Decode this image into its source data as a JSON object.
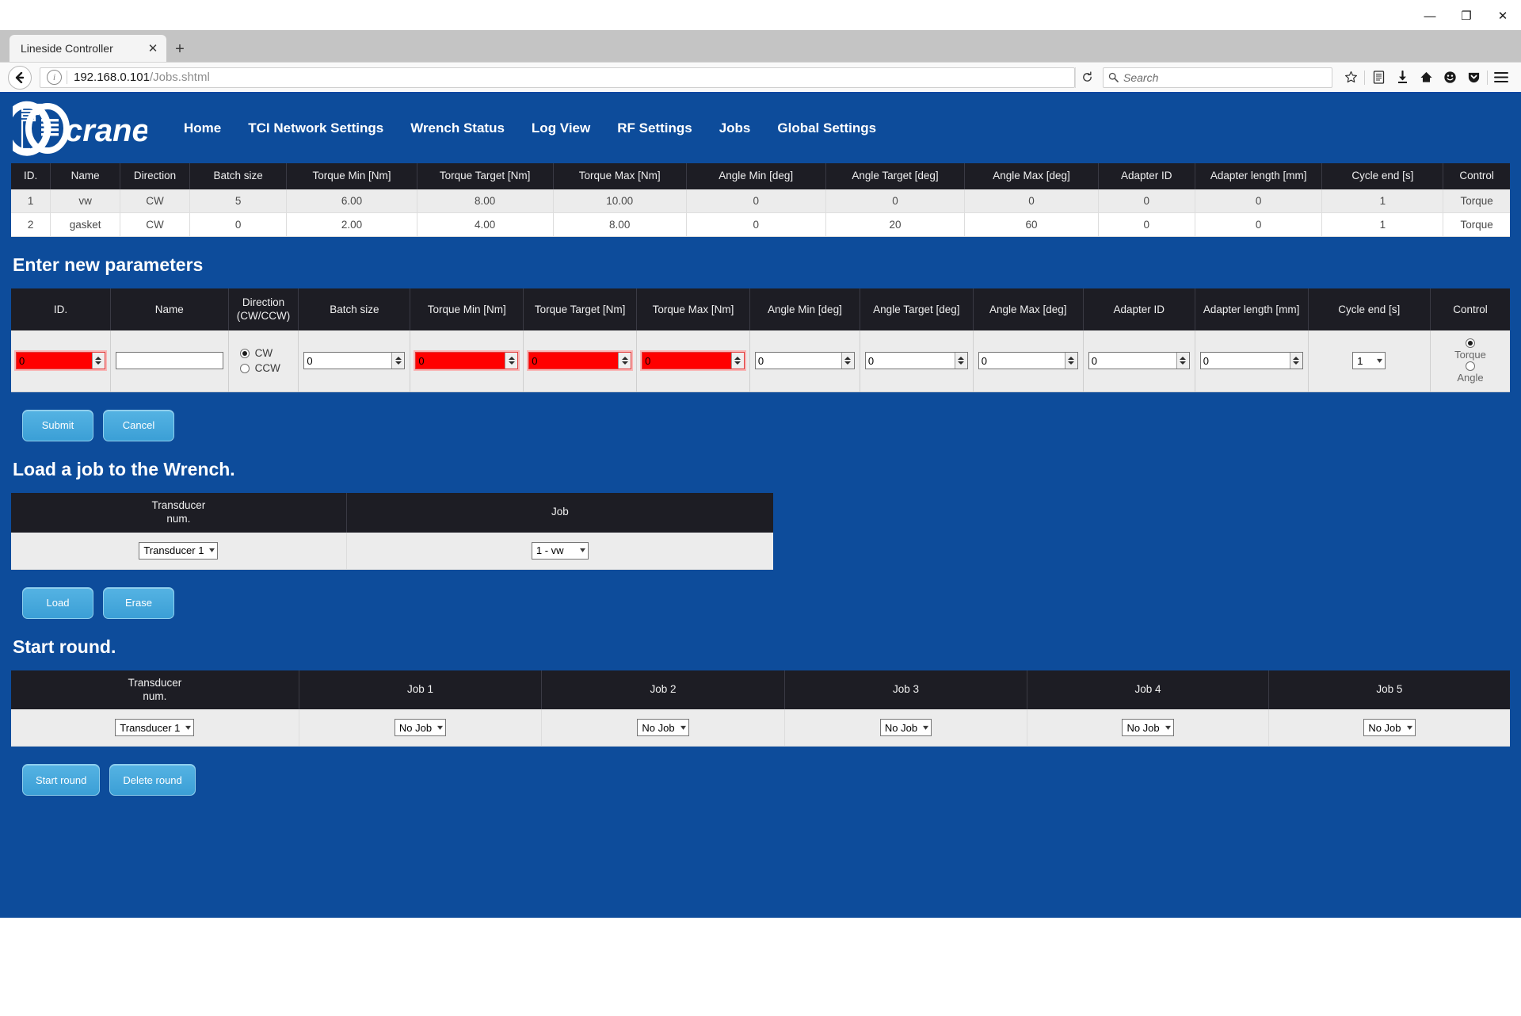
{
  "browser": {
    "tab_title": "Lineside Controller",
    "tab_close_icon": "close-icon",
    "new_tab_icon": "plus-icon",
    "window_minimize": "—",
    "window_restore": "❐",
    "window_close": "✕",
    "back_icon": "←",
    "info_icon": "i",
    "url_host": "192.168.0.101",
    "url_path": "/Jobs.shtml",
    "reload_icon": "↻",
    "search_placeholder": "Search",
    "toolbar_icons": [
      "star-icon",
      "reader-icon",
      "download-icon",
      "home-icon",
      "smiley-icon",
      "pocket-icon",
      "menu-icon"
    ]
  },
  "site": {
    "brand": "crane",
    "nav": [
      {
        "label": "Home"
      },
      {
        "label": "TCI Network Settings"
      },
      {
        "label": "Wrench Status"
      },
      {
        "label": "Log View"
      },
      {
        "label": "RF Settings"
      },
      {
        "label": "Jobs"
      },
      {
        "label": "Global Settings"
      }
    ]
  },
  "jobs_table": {
    "headers": [
      "ID.",
      "Name",
      "Direction",
      "Batch size",
      "Torque Min [Nm]",
      "Torque Target [Nm]",
      "Torque Max [Nm]",
      "Angle Min [deg]",
      "Angle Target [deg]",
      "Angle Max [deg]",
      "Adapter ID",
      "Adapter length [mm]",
      "Cycle end [s]",
      "Control"
    ],
    "rows": [
      {
        "id": "1",
        "name": "vw",
        "direction": "CW",
        "batch_size": "5",
        "torque_min": "6.00",
        "torque_target": "8.00",
        "torque_max": "10.00",
        "angle_min": "0",
        "angle_target": "0",
        "angle_max": "0",
        "adapter_id": "0",
        "adapter_length": "0",
        "cycle_end": "1",
        "control": "Torque"
      },
      {
        "id": "2",
        "name": "gasket",
        "direction": "CW",
        "batch_size": "0",
        "torque_min": "2.00",
        "torque_target": "4.00",
        "torque_max": "8.00",
        "angle_min": "0",
        "angle_target": "20",
        "angle_max": "60",
        "adapter_id": "0",
        "adapter_length": "0",
        "cycle_end": "1",
        "control": "Torque"
      }
    ]
  },
  "new_params": {
    "title": "Enter new parameters",
    "headers": {
      "id": "ID.",
      "name": "Name",
      "direction_l1": "Direction",
      "direction_l2": "(CW/CCW)",
      "batch_size": "Batch size",
      "torque_min": "Torque Min [Nm]",
      "torque_target": "Torque Target [Nm]",
      "torque_max": "Torque Max [Nm]",
      "angle_min": "Angle Min [deg]",
      "angle_target": "Angle Target [deg]",
      "angle_max": "Angle Max [deg]",
      "adapter_id": "Adapter ID",
      "adapter_length": "Adapter length [mm]",
      "cycle_end": "Cycle end [s]",
      "control": "Control"
    },
    "values": {
      "id": "0",
      "name": "",
      "name_placeholder": "",
      "batch_size": "0",
      "torque_min": "0",
      "torque_target": "0",
      "torque_max": "0",
      "angle_min": "0",
      "angle_target": "0",
      "angle_max": "0",
      "adapter_id": "0",
      "adapter_length": "0",
      "cycle_end": "1"
    },
    "direction": {
      "cw_label": "CW",
      "ccw_label": "CCW",
      "selected": "CW"
    },
    "control": {
      "torque_label": "Torque",
      "angle_label": "Angle",
      "selected": "Torque"
    },
    "invalid_fields": [
      "id",
      "torque_min",
      "torque_target",
      "torque_max"
    ],
    "invalid_color": "#ff0000",
    "buttons": {
      "submit": "Submit",
      "cancel": "Cancel"
    }
  },
  "load_job": {
    "title": "Load a job to the Wrench.",
    "headers": {
      "transducer_l1": "Transducer",
      "transducer_l2": "num.",
      "job": "Job"
    },
    "transducer_value": "Transducer 1",
    "job_value": "1 - vw",
    "buttons": {
      "load": "Load",
      "erase": "Erase"
    }
  },
  "start_round": {
    "title": "Start round.",
    "headers": {
      "transducer_l1": "Transducer",
      "transducer_l2": "num.",
      "job1": "Job 1",
      "job2": "Job 2",
      "job3": "Job 3",
      "job4": "Job 4",
      "job5": "Job 5"
    },
    "transducer_value": "Transducer 1",
    "job_values": [
      "No Job",
      "No Job",
      "No Job",
      "No Job",
      "No Job"
    ],
    "buttons": {
      "start": "Start round",
      "delete": "Delete round"
    }
  },
  "theme": {
    "page_blue": "#0d4c9b",
    "header_dark": "#1d1d24",
    "button_blue": "#3b9fd6"
  }
}
